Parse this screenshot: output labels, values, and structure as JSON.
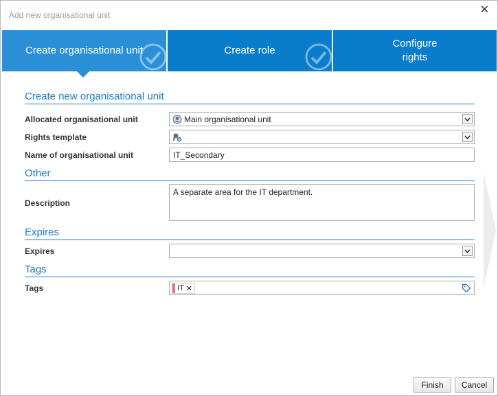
{
  "window": {
    "title": "Add new organisational unit",
    "close_icon": "close-icon"
  },
  "steps": [
    {
      "label": "Create organisational unit",
      "completed": true,
      "active": true
    },
    {
      "label": "Create role",
      "completed": true,
      "active": false
    },
    {
      "label": "Configure\nrights",
      "completed": false,
      "active": false
    }
  ],
  "sections": {
    "main": "Create new organisational unit",
    "other": "Other",
    "expires": "Expires",
    "tags": "Tags"
  },
  "fields": {
    "allocated_unit": {
      "label": "Allocated organisational unit",
      "value": "Main organisational unit",
      "icon": "org-unit-icon"
    },
    "rights_template": {
      "label": "Rights template",
      "value": "",
      "icon": "template-gear-icon"
    },
    "name": {
      "label": "Name of organisational unit",
      "value": "IT_Secondary"
    },
    "description": {
      "label": "Description",
      "value": "A separate area for the IT department."
    },
    "expires": {
      "label": "Expires",
      "value": ""
    },
    "tags": {
      "label": "Tags",
      "values": [
        "IT"
      ],
      "tag_color": "#e07a7a",
      "icon": "tag-icon"
    }
  },
  "buttons": {
    "finish": "Finish",
    "cancel": "Cancel"
  },
  "colors": {
    "accent": "#0a7ccc",
    "active_step": "#2b8fd8",
    "section_heading": "#1a7ac4"
  }
}
